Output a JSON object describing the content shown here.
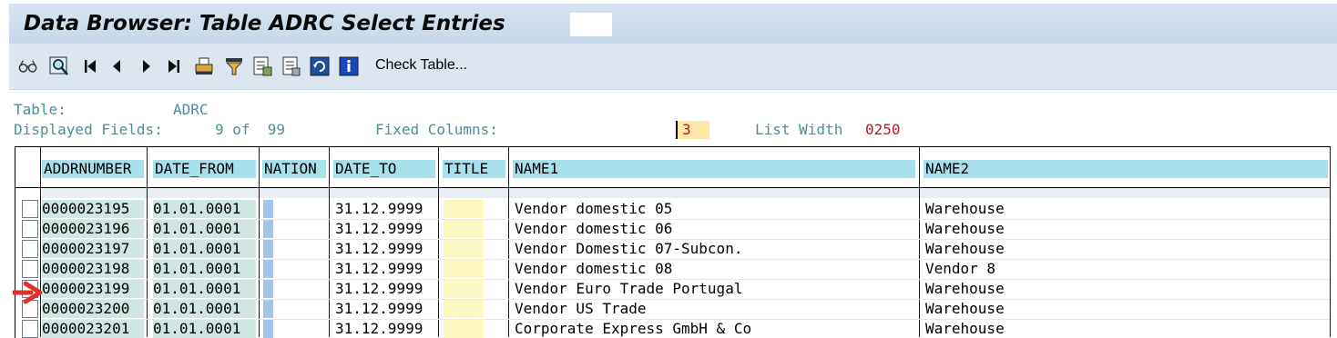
{
  "window": {
    "title": "Data Browser: Table ADRC Select Entries"
  },
  "toolbar": {
    "icons": [
      "glasses-icon",
      "find-icon",
      "first-page-icon",
      "previous-page-icon",
      "next-page-icon",
      "last-page-icon",
      "print-icon",
      "filter-icon",
      "export-icon",
      "details-icon",
      "refresh-icon",
      "info-icon"
    ],
    "check_table_label": "Check Table..."
  },
  "info": {
    "table_label": "Table:",
    "table_value": "ADRC",
    "displayed_fields_label": "Displayed Fields:",
    "displayed_fields_value": "9 of  99",
    "fixed_columns_label": "Fixed Columns:",
    "fixed_columns_value": "3",
    "list_width_label": "List Width",
    "list_width_value": "0250"
  },
  "table": {
    "columns": [
      "ADDRNUMBER",
      "DATE_FROM",
      "NATION",
      "DATE_TO",
      "TITLE",
      "NAME1",
      "NAME2"
    ],
    "rows": [
      {
        "addrnumber": "0000023195",
        "date_from": "01.01.0001",
        "nation": "",
        "date_to": "31.12.9999",
        "title": "",
        "name1": "Vendor domestic 05",
        "name2": "Warehouse"
      },
      {
        "addrnumber": "0000023196",
        "date_from": "01.01.0001",
        "nation": "",
        "date_to": "31.12.9999",
        "title": "",
        "name1": "Vendor domestic 06",
        "name2": "Warehouse"
      },
      {
        "addrnumber": "0000023197",
        "date_from": "01.01.0001",
        "nation": "",
        "date_to": "31.12.9999",
        "title": "",
        "name1": "Vendor Domestic 07-Subcon.",
        "name2": "Warehouse"
      },
      {
        "addrnumber": "0000023198",
        "date_from": "01.01.0001",
        "nation": "",
        "date_to": "31.12.9999",
        "title": "",
        "name1": "Vendor domestic 08",
        "name2": "Vendor 8"
      },
      {
        "addrnumber": "0000023199",
        "date_from": "01.01.0001",
        "nation": "",
        "date_to": "31.12.9999",
        "title": "",
        "name1": "Vendor Euro Trade Portugal",
        "name2": "Warehouse"
      },
      {
        "addrnumber": "0000023200",
        "date_from": "01.01.0001",
        "nation": "",
        "date_to": "31.12.9999",
        "title": "",
        "name1": "Vendor US Trade",
        "name2": "Warehouse"
      },
      {
        "addrnumber": "0000023201",
        "date_from": "01.01.0001",
        "nation": "",
        "date_to": "31.12.9999",
        "title": "",
        "name1": "Corporate Express GmbH & Co",
        "name2": "Warehouse"
      }
    ]
  },
  "colors": {
    "header_cell": "#a8e0ec",
    "key_cell": "#cfe6e2",
    "arrow": "#e0302a",
    "info_text": "#4a8f99",
    "value_red": "#c0191c"
  }
}
